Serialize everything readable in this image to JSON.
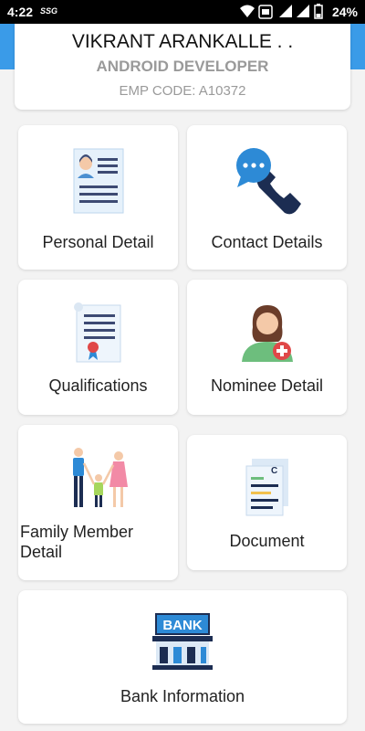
{
  "status_bar": {
    "time": "4:22",
    "carrier": "SSG",
    "battery": "24%"
  },
  "profile": {
    "name": "VIKRANT ARANKALLE . .",
    "role": "ANDROID DEVELOPER",
    "emp_code": "EMP CODE: A10372"
  },
  "menu": {
    "personal": "Personal Detail",
    "contact": "Contact Details",
    "qualifications": "Qualifications",
    "nominee": "Nominee Detail",
    "family_line1": "Family Member",
    "family_line2": "Detail",
    "document": "Document",
    "bank": "Bank Information",
    "bank_sign": "BANK",
    "doc_letter": "C"
  },
  "colors": {
    "accent": "#3a9be8"
  }
}
